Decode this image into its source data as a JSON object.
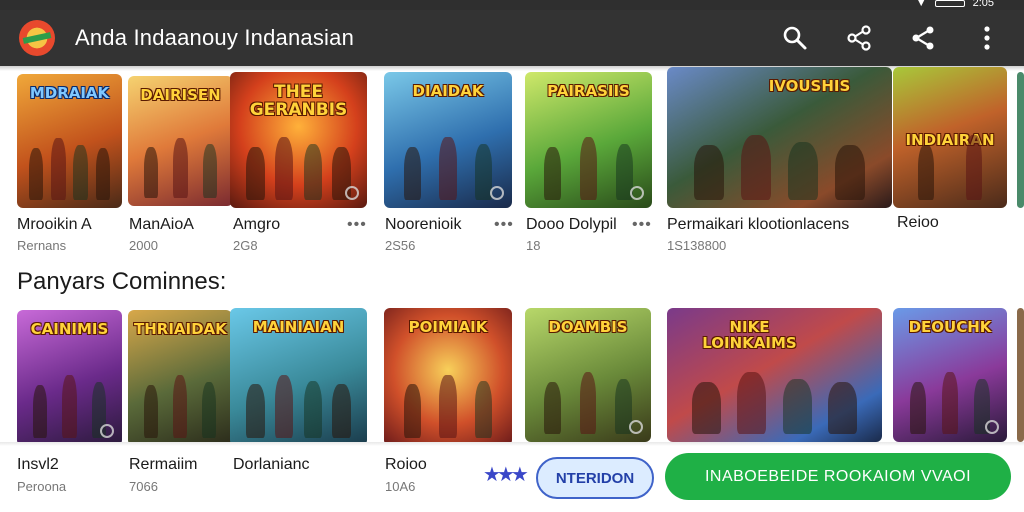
{
  "status": {
    "signal": "",
    "battery": "",
    "time": "2:05"
  },
  "app": {
    "title": "Anda Indaanouy Indanasian"
  },
  "actions": {
    "search": "search-icon",
    "share1": "share-icon",
    "share2": "share-icon",
    "more": "more-vert-icon"
  },
  "row1": [
    {
      "banner": "MDRAIAK",
      "title": "Mrooikin A",
      "sub": "Rernans",
      "more": ""
    },
    {
      "banner": "DAIRISEN",
      "title": "ManAioA",
      "sub": "2000",
      "more": ""
    },
    {
      "banner": "THEE GERANBIS",
      "title": "Amgro",
      "sub": "2G8",
      "more": "•••"
    },
    {
      "banner": "DIAIDAK",
      "title": "Noorenioik",
      "sub": "2S56",
      "more": "•••"
    },
    {
      "banner": "PAIRASIIS",
      "title": "Dooo Dolypil",
      "sub": "18",
      "more": "•••"
    },
    {
      "banner": "IVOUSHIS",
      "title": "Permaikari klootionlacens",
      "sub": "1S138800",
      "more": ""
    },
    {
      "banner": "INDIAIRAN",
      "title": "Reioo",
      "sub": "",
      "more": ""
    }
  ],
  "section2": {
    "title": "Panyars Cominnes:"
  },
  "row2": [
    {
      "banner": "CAINIMIS",
      "title": "Insvl2",
      "sub": "Peroona"
    },
    {
      "banner": "THRIAIDAK",
      "title": "Rermaiim",
      "sub": "7066"
    },
    {
      "banner": "MAINIAIAN",
      "title": "Dorlanianc",
      "sub": ""
    },
    {
      "banner": "POIMIAIK",
      "title": "Roioo",
      "sub": "10A6"
    },
    {
      "banner": "DOAMBIS",
      "title": "",
      "sub": ""
    },
    {
      "banner": "NIKE LOINKAIMS",
      "title": "",
      "sub": ""
    },
    {
      "banner": "DEOUCHK",
      "title": "",
      "sub": ""
    }
  ],
  "bottom": {
    "stars": "★★★",
    "outline_button": "NTERIDON",
    "primary_button": "INABOEBEIDE ROOKAIOM VVAOI"
  },
  "colors": {
    "appbar": "#333333",
    "primary": "#1fb046",
    "outline": "#3f63c9"
  }
}
